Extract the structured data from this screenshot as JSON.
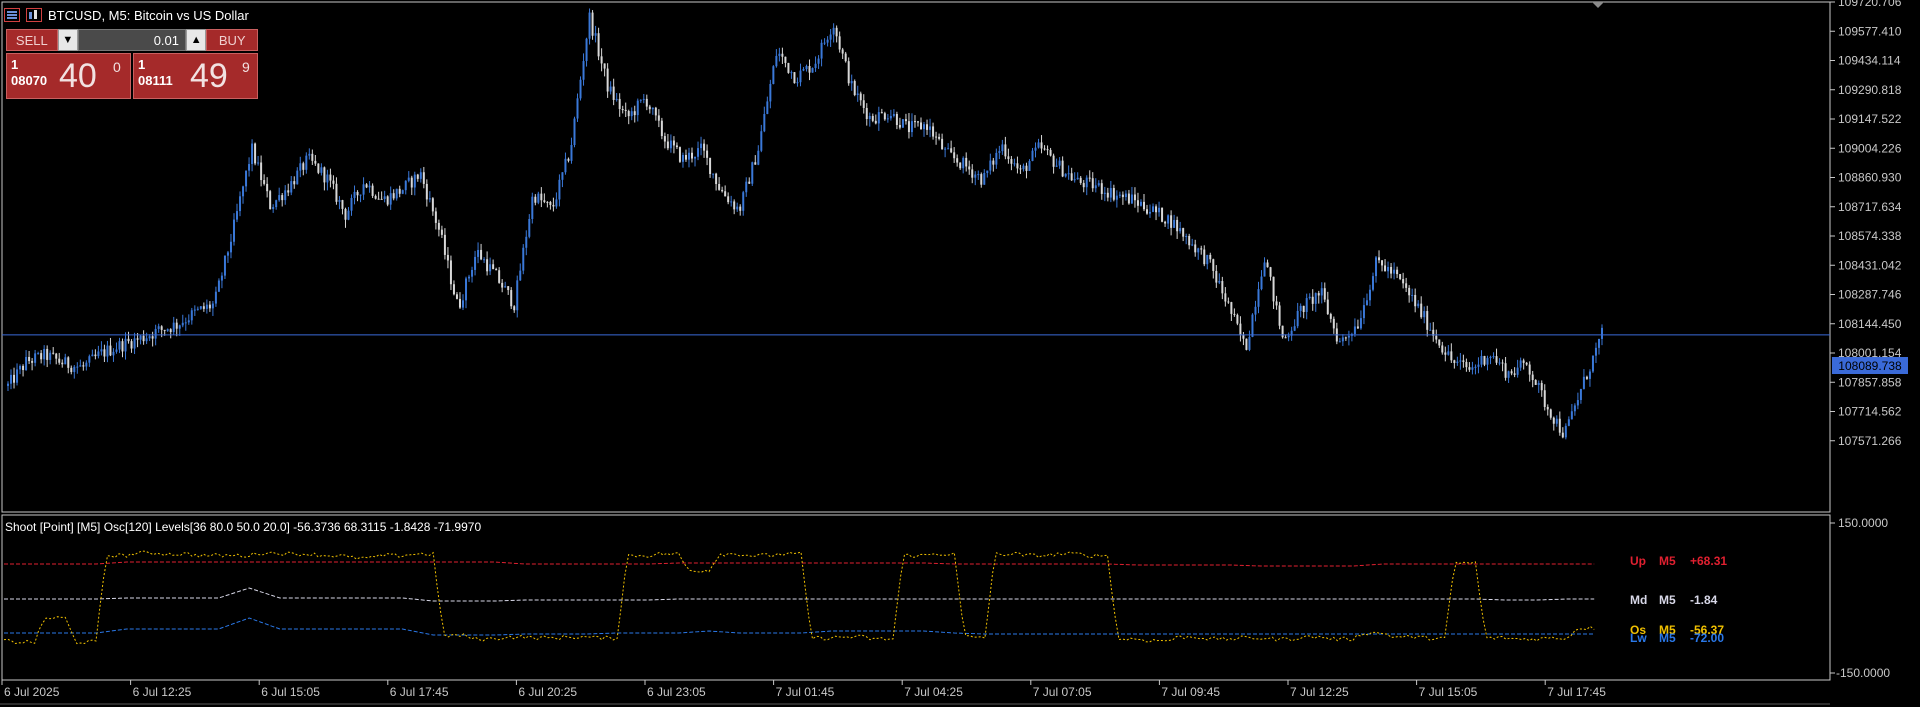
{
  "window": {
    "title": "BTCUSD, M5:  Bitcoin vs US Dollar"
  },
  "trade_panel": {
    "sell_label": "SELL",
    "buy_label": "BUY",
    "lot_value": "0.01",
    "sell_price": {
      "prefix_top": "1",
      "prefix_bottom": "08070",
      "big": "40",
      "sup": "0"
    },
    "buy_price": {
      "prefix_top": "1",
      "prefix_bottom": "08111",
      "big": "49",
      "sup": "9"
    }
  },
  "colors": {
    "background": "#000000",
    "frame": "#c8c8c8",
    "candle_up": "#3a78d8",
    "candle_down": "#d8d8d8",
    "bid_line": "#3a6ad8",
    "price_tag_bg": "#3a6ad8",
    "osc_up": "#e02030",
    "osc_md": "#d8d8e8",
    "osc_lw": "#2a78e8",
    "osc_os": "#f0c000"
  },
  "price_axis": {
    "ticks": [
      "109720.706",
      "109577.410",
      "109434.114",
      "109290.818",
      "109147.522",
      "109004.226",
      "108860.930",
      "108717.634",
      "108574.338",
      "108431.042",
      "108287.746",
      "108144.450",
      "108001.154",
      "107857.858",
      "107714.562",
      "107571.266"
    ],
    "current_price": "108089.738",
    "current_value": 108089.738
  },
  "time_axis": {
    "labels": [
      "6 Jul 2025",
      "6 Jul 12:25",
      "6 Jul 15:05",
      "6 Jul 17:45",
      "6 Jul 20:25",
      "6 Jul 23:05",
      "7 Jul 01:45",
      "7 Jul 04:25",
      "7 Jul 07:05",
      "7 Jul 09:45",
      "7 Jul 12:25",
      "7 Jul 15:05",
      "7 Jul 17:45"
    ]
  },
  "indicator": {
    "header": "Shoot [Point] [M5]  Osc[120]  Levels[36 80.0 50.0 20.0] -56.3736 68.3115 -1.8428 -71.9970",
    "axis_top": "150.0000",
    "axis_bottom": "-150.0000",
    "legend": [
      {
        "name": "Up",
        "tf": "M5",
        "value": "+68.31",
        "color": "#e02030"
      },
      {
        "name": "Md",
        "tf": "M5",
        "value": "-1.84",
        "color": "#d8d8e8"
      },
      {
        "name": "Os",
        "tf": "M5",
        "value": "-56.37",
        "color": "#f0c000"
      },
      {
        "name": "Lw",
        "tf": "M5",
        "value": "-72.00",
        "color": "#2a78e8"
      }
    ]
  },
  "chart_data": [
    {
      "type": "candlestick",
      "symbol": "BTCUSD",
      "timeframe": "M5",
      "ylim": [
        107500,
        109720
      ],
      "price_path": [
        107840,
        107960,
        107990,
        107950,
        107930,
        108000,
        108040,
        108070,
        108110,
        108140,
        108200,
        108240,
        108600,
        109000,
        108720,
        108820,
        108950,
        108860,
        108680,
        108840,
        108750,
        108800,
        108880,
        108600,
        108220,
        108500,
        108380,
        108240,
        108780,
        108700,
        109000,
        109650,
        109300,
        109150,
        109250,
        109050,
        108950,
        109000,
        108800,
        108700,
        109000,
        109480,
        109350,
        109420,
        109620,
        109300,
        109150,
        109180,
        109100,
        109120,
        108980,
        108920,
        108850,
        109020,
        108880,
        109010,
        108920,
        108840,
        108820,
        108780,
        108750,
        108700,
        108650,
        108550,
        108450,
        108250,
        108020,
        108480,
        108060,
        108220,
        108300,
        108050,
        108150,
        108450,
        108380,
        108250,
        108100,
        107960,
        107920,
        108000,
        107900,
        107950,
        107750,
        107600,
        107850,
        108090
      ]
    },
    {
      "type": "line",
      "title": "Shoot [Point] [M5]",
      "ylim": [
        -150,
        150
      ],
      "series": [
        {
          "name": "Up",
          "values": [
            68,
            68,
            68,
            68,
            72,
            72,
            72,
            72,
            72,
            72,
            72,
            72,
            72,
            72,
            72,
            72,
            72,
            68,
            68,
            68,
            68,
            68,
            70,
            70,
            70,
            70,
            70,
            70,
            70,
            70,
            70,
            68,
            68,
            68,
            68,
            68,
            68,
            66,
            66,
            66,
            66,
            64,
            64,
            64,
            64,
            68,
            68,
            68,
            68,
            68,
            68,
            68,
            68
          ]
        },
        {
          "name": "Md",
          "values": [
            -2,
            -2,
            -2,
            -2,
            0,
            0,
            0,
            0,
            20,
            0,
            0,
            0,
            0,
            0,
            -6,
            -6,
            -6,
            -4,
            -4,
            -4,
            -4,
            -4,
            -2,
            -2,
            -2,
            -2,
            -2,
            -2,
            -2,
            -2,
            -2,
            -2,
            -2,
            -2,
            -2,
            -2,
            -2,
            -2,
            -2,
            -2,
            -2,
            -2,
            -2,
            -2,
            -2,
            -2,
            -2,
            -2,
            -2,
            -4,
            -4,
            -2,
            -2
          ]
        },
        {
          "name": "Lw",
          "values": [
            -70,
            -70,
            -70,
            -70,
            -62,
            -62,
            -62,
            -62,
            -40,
            -62,
            -62,
            -62,
            -62,
            -62,
            -74,
            -74,
            -74,
            -72,
            -72,
            -72,
            -70,
            -70,
            -70,
            -66,
            -70,
            -70,
            -70,
            -66,
            -66,
            -66,
            -66,
            -70,
            -72,
            -72,
            -72,
            -72,
            -72,
            -72,
            -72,
            -72,
            -72,
            -72,
            -72,
            -72,
            -72,
            -72,
            -72,
            -72,
            -72,
            -72,
            -72,
            -72,
            -72
          ]
        },
        {
          "name": "Os",
          "values": [
            -85,
            -88,
            -40,
            -88,
            85,
            90,
            88,
            85,
            85,
            90,
            88,
            85,
            80,
            85,
            88,
            -75,
            -82,
            -78,
            -80,
            -78,
            -80,
            85,
            88,
            55,
            88,
            85,
            88,
            -80,
            -78,
            -82,
            85,
            88,
            -78,
            88,
            85,
            88,
            85,
            -82,
            -85,
            -78,
            -82,
            -80,
            -82,
            -78,
            -82,
            -70,
            -78,
            -80,
            70,
            -80,
            -82,
            -80,
            -60
          ]
        }
      ]
    }
  ]
}
